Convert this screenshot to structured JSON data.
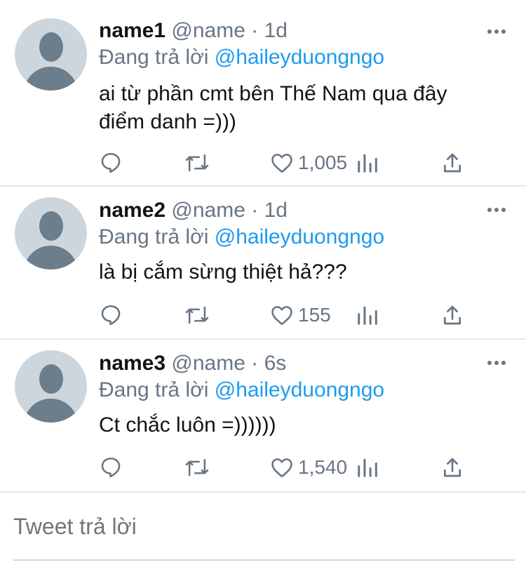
{
  "tweets": [
    {
      "name": "name1",
      "handle_time": "@name · 1d",
      "reply_prefix": "Đang trả lời",
      "reply_handle": "@haileyduongngo",
      "content_line1": "ai từ phần cmt bên Thế Nam qua đây",
      "content_line2": "điểm danh =)))",
      "likes": "1,005"
    },
    {
      "name": "name2",
      "handle_time": "@name · 1d",
      "reply_prefix": "Đang trả lời",
      "reply_handle": "@haileyduongngo",
      "content_line1": "là bị cắm sừng thiệt hả???",
      "likes": "155"
    },
    {
      "name": "name3",
      "handle_time": "@name · 6s",
      "reply_prefix": "Đang trả lời",
      "reply_handle": "@haileyduongngo",
      "content_line1": "Ct chắc luôn =))))))",
      "likes": "1,540"
    }
  ],
  "compose": {
    "placeholder": "Tweet trả lời"
  },
  "icons": {
    "reply": "reply-icon",
    "retweet": "retweet-icon",
    "like": "heart-icon",
    "analytics": "analytics-icon",
    "share": "share-icon",
    "more": "more-icon"
  },
  "colors": {
    "link": "#1d9bf0",
    "secondary_text": "#687684",
    "primary_text": "#0f1419",
    "avatar_bg": "#cdd6dd",
    "avatar_fg": "#6c7d8b",
    "divider": "#e4e7ea"
  }
}
